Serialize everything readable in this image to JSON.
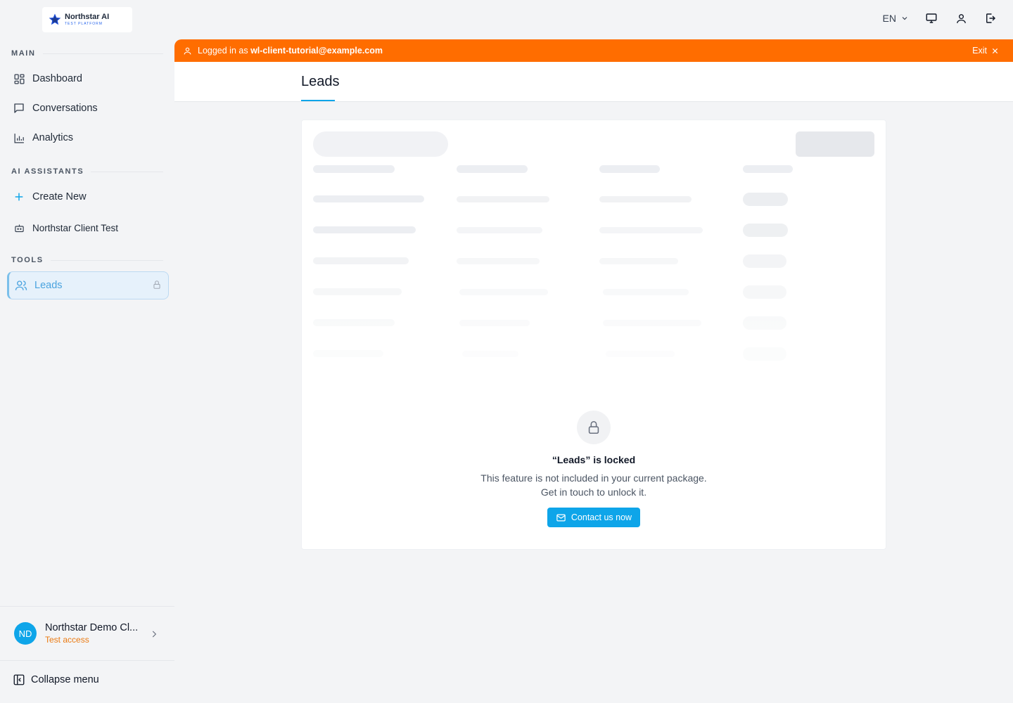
{
  "brand": {
    "name": "Northstar AI",
    "tagline": "TEST PLATFORM"
  },
  "sidebar": {
    "main_label": "MAIN",
    "main_items": [
      {
        "label": "Dashboard",
        "icon": "dashboard-icon"
      },
      {
        "label": "Conversations",
        "icon": "chat-icon"
      },
      {
        "label": "Analytics",
        "icon": "bar-chart-icon"
      }
    ],
    "assistants_label": "AI ASSISTANTS",
    "assistant_items": [
      {
        "label": "Create New",
        "icon": "plus-icon"
      },
      {
        "label": "Northstar Client Test",
        "icon": "bot-icon"
      }
    ],
    "tools_label": "TOOLS",
    "tool_items": [
      {
        "label": "Leads",
        "icon": "users-icon",
        "locked": true
      }
    ],
    "account": {
      "initials": "ND",
      "name": "Northstar Demo Cl...",
      "tier": "Test access"
    },
    "collapse_label": "Collapse menu"
  },
  "topbar": {
    "language": "EN"
  },
  "banner": {
    "prefix": "Logged in as",
    "email": "wl-client-tutorial@example.com",
    "exit_label": "Exit"
  },
  "page": {
    "title": "Leads"
  },
  "locked": {
    "title": "“Leads” is locked",
    "line1": "This feature is not included in your current package.",
    "line2": "Get in touch to unlock it.",
    "button_label": "Contact us now"
  },
  "colors": {
    "accent": "#0ea5e9",
    "banner": "#ff6d00",
    "tier": "#ea7a12"
  }
}
